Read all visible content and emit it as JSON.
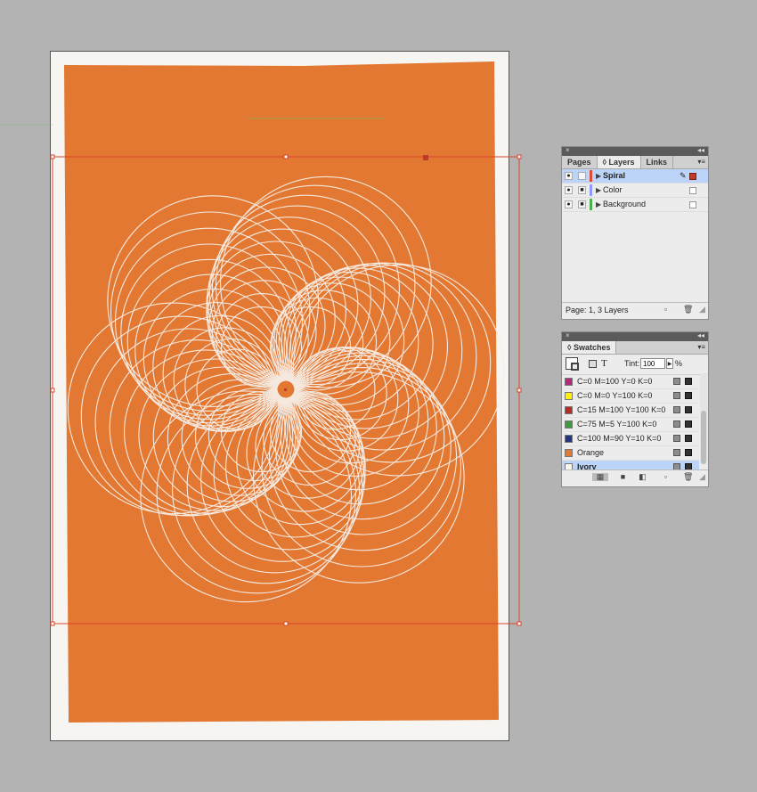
{
  "layers_panel": {
    "close_glyph": "×",
    "collapse_glyph": "◂◂",
    "menu_glyph": "▾≡",
    "tabs": [
      {
        "label": "Pages",
        "active": false
      },
      {
        "label": "Layers",
        "active": true
      },
      {
        "label": "Links",
        "active": false
      }
    ],
    "layers": [
      {
        "name": "Spiral",
        "color": "#e34a33",
        "selected": true
      },
      {
        "name": "Color",
        "color": "#8e9cff",
        "selected": false
      },
      {
        "name": "Background",
        "color": "#4caf50",
        "selected": false
      }
    ],
    "status": "Page: 1, 3 Layers"
  },
  "swatches_panel": {
    "close_glyph": "×",
    "collapse_glyph": "◂◂",
    "menu_glyph": "▾≡",
    "tab_label": "Swatches",
    "tint_label": "Tint:",
    "tint_value": "100",
    "tint_unit": "%",
    "text_tool_glyph": "T",
    "swatches": [
      {
        "name": "C=0 M=100 Y=0 K=0",
        "color": "#b5287c",
        "selected": false
      },
      {
        "name": "C=0 M=0 Y=100 K=0",
        "color": "#fff200",
        "selected": false
      },
      {
        "name": "C=15 M=100 Y=100 K=0",
        "color": "#b92a26",
        "selected": false
      },
      {
        "name": "C=75 M=5 Y=100 K=0",
        "color": "#3f9a3b",
        "selected": false
      },
      {
        "name": "C=100 M=90 Y=10 K=0",
        "color": "#233480",
        "selected": false
      },
      {
        "name": "Orange",
        "color": "#e07a30",
        "selected": false
      },
      {
        "name": "Ivory",
        "color": "#fbf7ee",
        "selected": true
      }
    ]
  },
  "canvas": {
    "background_color": "#e37832",
    "spiral_color": "#f6efe8",
    "selection_color": "#d9452a"
  }
}
